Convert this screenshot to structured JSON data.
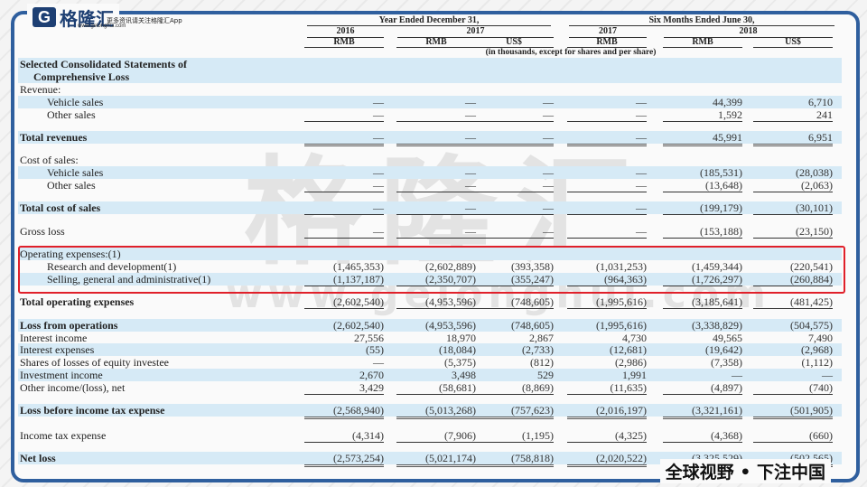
{
  "brand": {
    "logo_text": "格隆汇",
    "logo_url_text": "www.gelonghui.com",
    "slogan": "更多资讯请关注格隆汇App",
    "footer": "全球视野 • 下注中国",
    "watermark": "格隆汇",
    "watermark_url": "www.gelonghui.com"
  },
  "header": {
    "group1": "Year Ended December 31,",
    "group2": "Six Months Ended June 30,",
    "years": [
      "2016",
      "2017",
      "2017",
      "2018"
    ],
    "currencies": [
      "RMB",
      "RMB",
      "US$",
      "RMB",
      "RMB",
      "US$"
    ],
    "note": "(in thousands, except for shares and per share)"
  },
  "rows": [
    {
      "label": "Selected Consolidated Statements of",
      "bold": true,
      "shaded": true,
      "indent": 0,
      "values": []
    },
    {
      "label": "Comprehensive Loss",
      "bold": true,
      "shaded": true,
      "indent": 1,
      "values": []
    },
    {
      "label": "Revenue:",
      "indent": 0,
      "values": []
    },
    {
      "label": "Vehicle sales",
      "indent": 2,
      "shaded": true,
      "values": [
        "—",
        "—",
        "—",
        "—",
        "44,399",
        "6,710"
      ]
    },
    {
      "label": "Other sales",
      "indent": 2,
      "rule": "u",
      "values": [
        "—",
        "—",
        "—",
        "—",
        "1,592",
        "241"
      ]
    },
    {
      "label": "Total revenues",
      "bold": true,
      "shaded": true,
      "rule": "d",
      "values": [
        "—",
        "—",
        "—",
        "—",
        "45,991",
        "6,951"
      ]
    },
    {
      "label": "Cost of sales:",
      "values": []
    },
    {
      "label": "Vehicle sales",
      "indent": 2,
      "shaded": true,
      "values": [
        "—",
        "—",
        "—",
        "—",
        "(185,531)",
        "(28,038)"
      ]
    },
    {
      "label": "Other sales",
      "indent": 2,
      "rule": "u",
      "values": [
        "—",
        "—",
        "—",
        "—",
        "(13,648)",
        "(2,063)"
      ]
    },
    {
      "label": "Total cost of sales",
      "bold": true,
      "shaded": true,
      "rule": "u",
      "values": [
        "—",
        "—",
        "—",
        "—",
        "(199,179)",
        "(30,101)"
      ]
    },
    {
      "label": "Gross loss",
      "rule": "u",
      "values": [
        "—",
        "—",
        "—",
        "—",
        "(153,188)",
        "(23,150)"
      ]
    },
    {
      "label": "Operating expenses:(1)",
      "shaded": true,
      "values": []
    },
    {
      "label": "Research and development(1)",
      "indent": 2,
      "values": [
        "(1,465,353)",
        "(2,602,889)",
        "(393,358)",
        "(1,031,253)",
        "(1,459,344)",
        "(220,541)"
      ]
    },
    {
      "label": "Selling, general and administrative(1)",
      "indent": 2,
      "shaded": true,
      "rule": "u",
      "values": [
        "(1,137,187)",
        "(2,350,707)",
        "(355,247)",
        "(964,363)",
        "(1,726,297)",
        "(260,884)"
      ]
    },
    {
      "label": "Total operating expenses",
      "bold": true,
      "rule": "u",
      "values": [
        "(2,602,540)",
        "(4,953,596)",
        "(748,605)",
        "(1,995,616)",
        "(3,185,641)",
        "(481,425)"
      ]
    },
    {
      "label": "Loss from operations",
      "bold": true,
      "shaded": true,
      "values": [
        "(2,602,540)",
        "(4,953,596)",
        "(748,605)",
        "(1,995,616)",
        "(3,338,829)",
        "(504,575)"
      ]
    },
    {
      "label": "Interest income",
      "values": [
        "27,556",
        "18,970",
        "2,867",
        "4,730",
        "49,565",
        "7,490"
      ]
    },
    {
      "label": "Interest expenses",
      "shaded": true,
      "values": [
        "(55)",
        "(18,084)",
        "(2,733)",
        "(12,681)",
        "(19,642)",
        "(2,968)"
      ]
    },
    {
      "label": "Shares of losses of equity investee",
      "values": [
        "—",
        "(5,375)",
        "(812)",
        "(2,986)",
        "(7,358)",
        "(1,112)"
      ]
    },
    {
      "label": "Investment income",
      "shaded": true,
      "values": [
        "2,670",
        "3,498",
        "529",
        "1,991",
        "—",
        "—"
      ]
    },
    {
      "label": "Other income/(loss), net",
      "rule": "u",
      "values": [
        "3,429",
        "(58,681)",
        "(8,869)",
        "(11,635)",
        "(4,897)",
        "(740)"
      ]
    },
    {
      "label": "Loss before income tax expense",
      "bold": true,
      "shaded": true,
      "rule": "d",
      "values": [
        "(2,568,940)",
        "(5,013,268)",
        "(757,623)",
        "(2,016,197)",
        "(3,321,161)",
        "(501,905)"
      ]
    },
    {
      "label": "Income tax expense",
      "rule": "u",
      "values": [
        "(4,314)",
        "(7,906)",
        "(1,195)",
        "(4,325)",
        "(4,368)",
        "(660)"
      ]
    },
    {
      "label": "Net loss",
      "bold": true,
      "shaded": true,
      "rule": "d",
      "values": [
        "(2,573,254)",
        "(5,021,174)",
        "(758,818)",
        "(2,020,522)",
        "(3,325,529)",
        "(502,565)"
      ]
    }
  ]
}
